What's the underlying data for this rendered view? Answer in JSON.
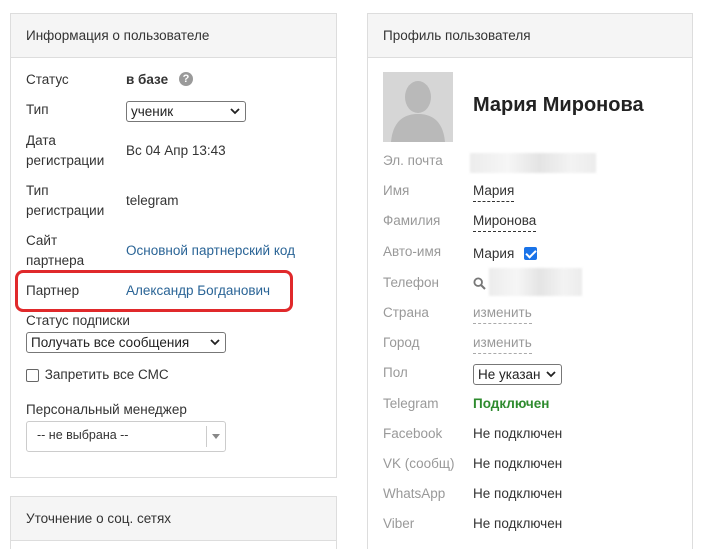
{
  "user_info": {
    "header": "Информация о пользователе",
    "status_label": "Статус",
    "status_value": "в базе",
    "help_glyph": "?",
    "type_label": "Тип",
    "type_value": "ученик",
    "reg_date_label_1": "Дата",
    "reg_date_label_2": "регистрации",
    "reg_date_value": "Вс 04 Апр 13:43",
    "reg_type_label_1": "Тип",
    "reg_type_label_2": "регистрации",
    "reg_type_value": "telegram",
    "partner_site_label_1": "Сайт",
    "partner_site_label_2": "партнера",
    "partner_site_value": "Основной партнерский код",
    "partner_label": "Партнер",
    "partner_value": "Александр Богданович",
    "subscription_label": "Статус подписки",
    "subscription_value": "Получать все сообщения",
    "sms_label": "Запретить все СМС",
    "sms_checked": false,
    "manager_label": "Персональный менеджер",
    "manager_value": "-- не выбрана --"
  },
  "social": {
    "header": "Уточнение о соц. сетях"
  },
  "profile": {
    "header": "Профиль пользователя",
    "name": "Мария Миронова",
    "email_label": "Эл. почта",
    "first_name_label": "Имя",
    "first_name_value": "Мария",
    "last_name_label": "Фамилия",
    "last_name_value": "Миронова",
    "auto_name_label": "Авто-имя",
    "auto_name_value": "Мария",
    "auto_name_checked": true,
    "phone_label": "Телефон",
    "country_label": "Страна",
    "country_value": "изменить",
    "city_label": "Город",
    "city_value": "изменить",
    "gender_label": "Пол",
    "gender_value": "Не указан",
    "telegram_label": "Telegram",
    "telegram_value": "Подключен",
    "facebook_label": "Facebook",
    "facebook_value": "Не подключен",
    "vk_label": "VK (сообщ)",
    "vk_value": "Не подключен",
    "whatsapp_label": "WhatsApp",
    "whatsapp_value": "Не подключен",
    "viber_label": "Viber",
    "viber_value": "Не подключен"
  },
  "colors": {
    "link": "#2a6496",
    "highlight": "#e0292b",
    "connected": "#2e8b2e",
    "header_bg": "#f5f5f5"
  }
}
